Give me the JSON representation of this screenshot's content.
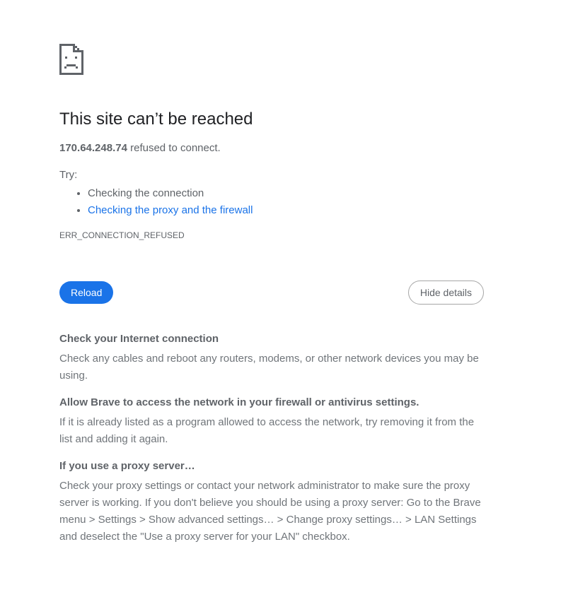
{
  "error": {
    "icon": "sad-document-icon",
    "title": "This site can’t be reached",
    "host": "170.64.248.74",
    "message": " refused to connect.",
    "try_label": "Try:",
    "suggestions": [
      {
        "label": "Checking the connection",
        "link": false
      },
      {
        "label": "Checking the proxy and the firewall",
        "link": true
      }
    ],
    "code": "ERR_CONNECTION_REFUSED"
  },
  "buttons": {
    "reload_label": "Reload",
    "details_label": "Hide details"
  },
  "details": [
    {
      "heading": "Check your Internet connection",
      "body": "Check any cables and reboot any routers, modems, or other network devices you may be using."
    },
    {
      "heading": "Allow Brave to access the network in your firewall or antivirus settings.",
      "body": "If it is already listed as a program allowed to access the network, try removing it from the list and adding it again."
    },
    {
      "heading": "If you use a proxy server…",
      "body": "Check your proxy settings or contact your network administrator to make sure the proxy server is working. If you don't believe you should be using a proxy server: Go to the Brave menu > Settings > Show advanced settings… > Change proxy settings… > LAN Settings and deselect the \"Use a proxy server for your LAN\" checkbox."
    }
  ],
  "colors": {
    "accent": "#1a73e8",
    "title": "#202124",
    "text": "#5f6368"
  }
}
